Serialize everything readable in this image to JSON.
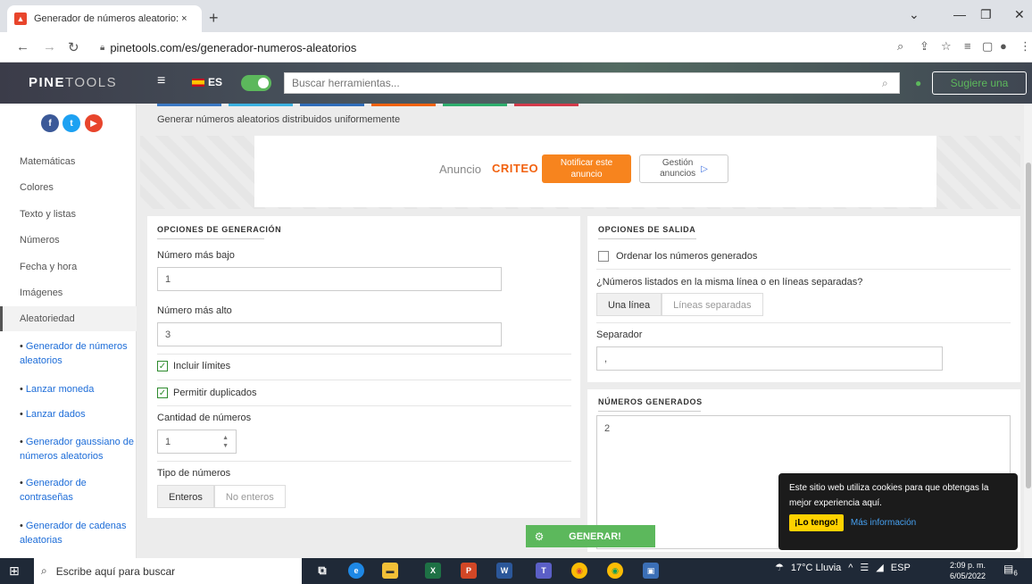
{
  "browser": {
    "tab_title": "Generador de números aleatorio: ×",
    "url": "pinetools.com/es/generador-numeros-aleatorios"
  },
  "header": {
    "logo_bold": "PINE",
    "logo_light": "TOOLS",
    "lang": "ES",
    "search_placeholder": "Buscar herramientas...",
    "suggest_label": "Sugiere una"
  },
  "sidebar": {
    "categories": [
      "Matemáticas",
      "Colores",
      "Texto y listas",
      "Números",
      "Fecha y hora",
      "Imágenes",
      "Aleatoriedad"
    ],
    "subitems": [
      "Generador de números aleatorios",
      "Lanzar moneda",
      "Lanzar dados",
      "Generador gaussiano de números aleatorios",
      "Generador de contraseñas",
      "Generador de cadenas aleatorias"
    ]
  },
  "main": {
    "subtitle": "Generar números aleatorios distribuidos uniformemente"
  },
  "ad": {
    "label": "Anuncio",
    "brand": "CRITEO",
    "notify_line1": "Notificar este",
    "notify_line2": "anuncio",
    "manage_line1": "Gestión",
    "manage_line2": "anuncios"
  },
  "gen_options": {
    "title": "OPCIONES DE GENERACIÓN",
    "min_label": "Número más bajo",
    "min_value": "1",
    "max_label": "Número más alto",
    "max_value": "3",
    "include_limits": "Incluir límites",
    "allow_duplicates": "Permitir duplicados",
    "count_label": "Cantidad de números",
    "count_value": "1",
    "type_label": "Tipo de números",
    "type_integer": "Enteros",
    "type_decimal": "No enteros"
  },
  "out_options": {
    "title": "OPCIONES DE SALIDA",
    "sort_label": "Ordenar los números generados",
    "layout_question": "¿Números listados en la misma línea o en líneas separadas?",
    "one_line": "Una línea",
    "separate_lines": "Líneas separadas",
    "separator_label": "Separador",
    "separator_value": ","
  },
  "result": {
    "title": "NÚMEROS GENERADOS",
    "value": "2"
  },
  "generate_label": "GENERAR!",
  "cookie": {
    "text": "Este sitio web utiliza cookies para que obtengas la mejor experiencia aquí.",
    "accept": "¡Lo tengo!",
    "more": "Más información"
  },
  "taskbar": {
    "search_placeholder": "Escribe aquí para buscar",
    "weather": "17°C Lluvia",
    "keyboard": "ESP",
    "time": "2:09 p. m.",
    "date": "6/05/2022",
    "notifications": "6"
  }
}
